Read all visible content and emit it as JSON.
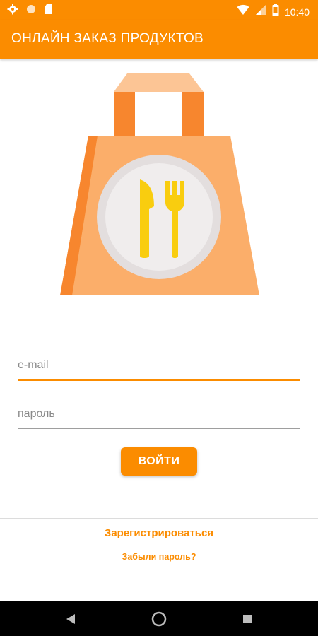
{
  "status_bar": {
    "time": "10:40",
    "icons_left": [
      "gear-icon",
      "circle-icon",
      "sd-card-icon"
    ],
    "icons_right": [
      "wifi-icon",
      "signal-icon",
      "battery-icon"
    ]
  },
  "app_bar": {
    "title": "ОНЛАЙН ЗАКАЗ ПРОДУКТОВ"
  },
  "hero": {
    "icon": "shopping-bag-food-icon"
  },
  "login_form": {
    "email_value": "",
    "email_placeholder": "e-mail",
    "password_value": "",
    "password_placeholder": "пароль",
    "submit_label": "ВОЙТИ"
  },
  "links": {
    "register": "Зарегистрироваться",
    "forgot_password": "Забыли пароль?"
  },
  "nav_bar": {
    "buttons": [
      "back-icon",
      "home-icon",
      "recents-icon"
    ]
  },
  "colors": {
    "accent": "#FB8C00",
    "bag_body": "#FBAE6A",
    "bag_dark": "#F7862E",
    "plate": "#F0EDED",
    "cutlery": "#F9CD0F"
  }
}
